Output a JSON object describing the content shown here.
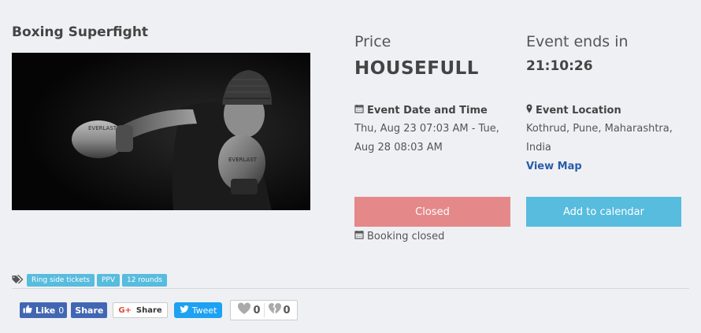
{
  "event": {
    "title": "Boxing Superfight",
    "image_alt": "boxer-photo"
  },
  "price": {
    "label": "Price",
    "value": "HOUSEFULL"
  },
  "countdown": {
    "label": "Event ends in",
    "value": "21:10:26"
  },
  "date": {
    "heading": "Event Date and Time",
    "text": "Thu, Aug 23 07:03 AM - Tue, Aug 28 08:03 AM",
    "icon": "calendar-icon"
  },
  "location": {
    "heading": "Event Location",
    "text": "Kothrud, Pune, Maharashtra, India",
    "view_map": "View Map",
    "icon": "map-marker-icon"
  },
  "actions": {
    "closed_label": "Closed",
    "calendar_label": "Add to calendar",
    "booking_status": "Booking closed"
  },
  "tags": [
    "Ring side tickets",
    "PPV",
    "12 rounds"
  ],
  "social": {
    "fb_like_label": "Like",
    "fb_like_count": "0",
    "fb_share_label": "Share",
    "gplus_label": "Share",
    "gplus_icon_text": "G+",
    "tweet_label": "Tweet",
    "likes": "0",
    "dislikes": "0"
  },
  "colors": {
    "closed_button": "#e5888a",
    "calendar_button": "#57bcde",
    "tag": "#57bcde",
    "link": "#2a5ca8",
    "facebook": "#4267b2",
    "twitter": "#1da1f2"
  }
}
